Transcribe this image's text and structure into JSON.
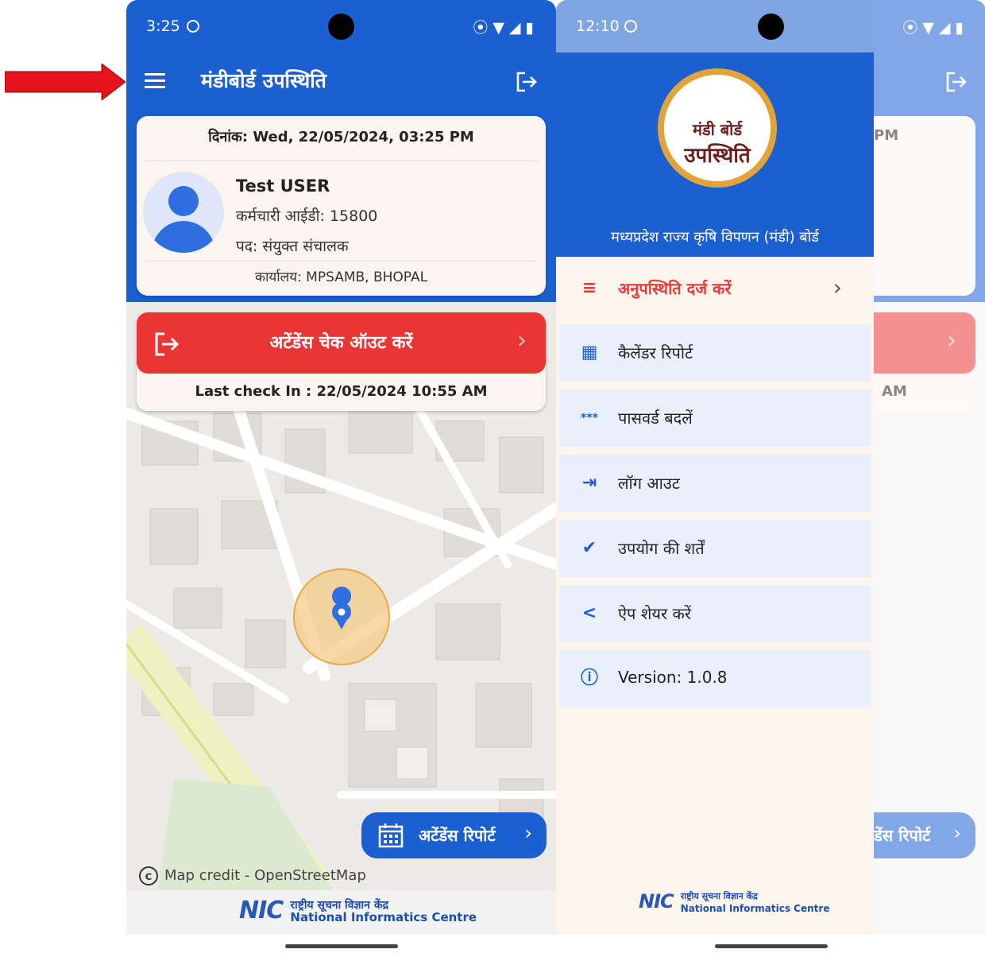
{
  "colors": {
    "primary_blue": "#1b5fd1",
    "checkout_red": "#ea3535",
    "card_bg": "#fbf5ef",
    "annotation_arrow": "#e8141b"
  },
  "screen1": {
    "status": {
      "time": "3:25"
    },
    "app_title": "मंडीबोर्ड उपस्थिति",
    "profile": {
      "date_line": "दिनांक: Wed, 22/05/2024, 03:25 PM",
      "name": "Test USER",
      "employee_id": "कर्मचारी आईडी: 15800",
      "designation": "पद: संयुक्त संचालक",
      "office": "कार्यालय: MPSAMB, BHOPAL"
    },
    "checkout_button": "अटेंडेंस चेक ऑउट करें",
    "last_checkin": "Last check In : 22/05/2024 10:55 AM",
    "report_button": "अटेंडेंस रिपोर्ट",
    "map_credit": "Map credit - OpenStreetMap",
    "footer": {
      "org_hindi": "राष्ट्रीय सूचना विज्ञान केंद्र",
      "org_english": "National Informatics Centre",
      "logo_mark": "NIC"
    }
  },
  "screen2": {
    "status": {
      "time": "12:10"
    },
    "logo": {
      "line1": "मंडी बोर्ड",
      "line2": "उपस्थिति"
    },
    "board_name": "मध्यप्रदेश राज्य कृषि विपणन (मंडी) बोर्ड",
    "menu": [
      {
        "label": "अनुपस्थिति दर्ज करें",
        "icon": "list-icon"
      },
      {
        "label": "कैलेंडर रिपोर्ट",
        "icon": "calendar-icon"
      },
      {
        "label": "पासवर्ड बदलें",
        "icon": "password-icon"
      },
      {
        "label": "लॉग आउट",
        "icon": "logout-icon"
      },
      {
        "label": "उपयोग की शर्तें",
        "icon": "verified-icon"
      },
      {
        "label": "ऐप शेयर करें",
        "icon": "share-icon"
      },
      {
        "label": "Version: 1.0.8",
        "icon": "info-icon"
      }
    ],
    "peek": {
      "date_tail": "PM",
      "checkin_tail": "AM",
      "report_tail": "डेंस रिपोर्ट"
    },
    "footer": {
      "org_hindi": "राष्ट्रीय सूचना विज्ञान केंद्र",
      "org_english": "National Informatics Centre",
      "logo_mark": "NIC"
    }
  }
}
